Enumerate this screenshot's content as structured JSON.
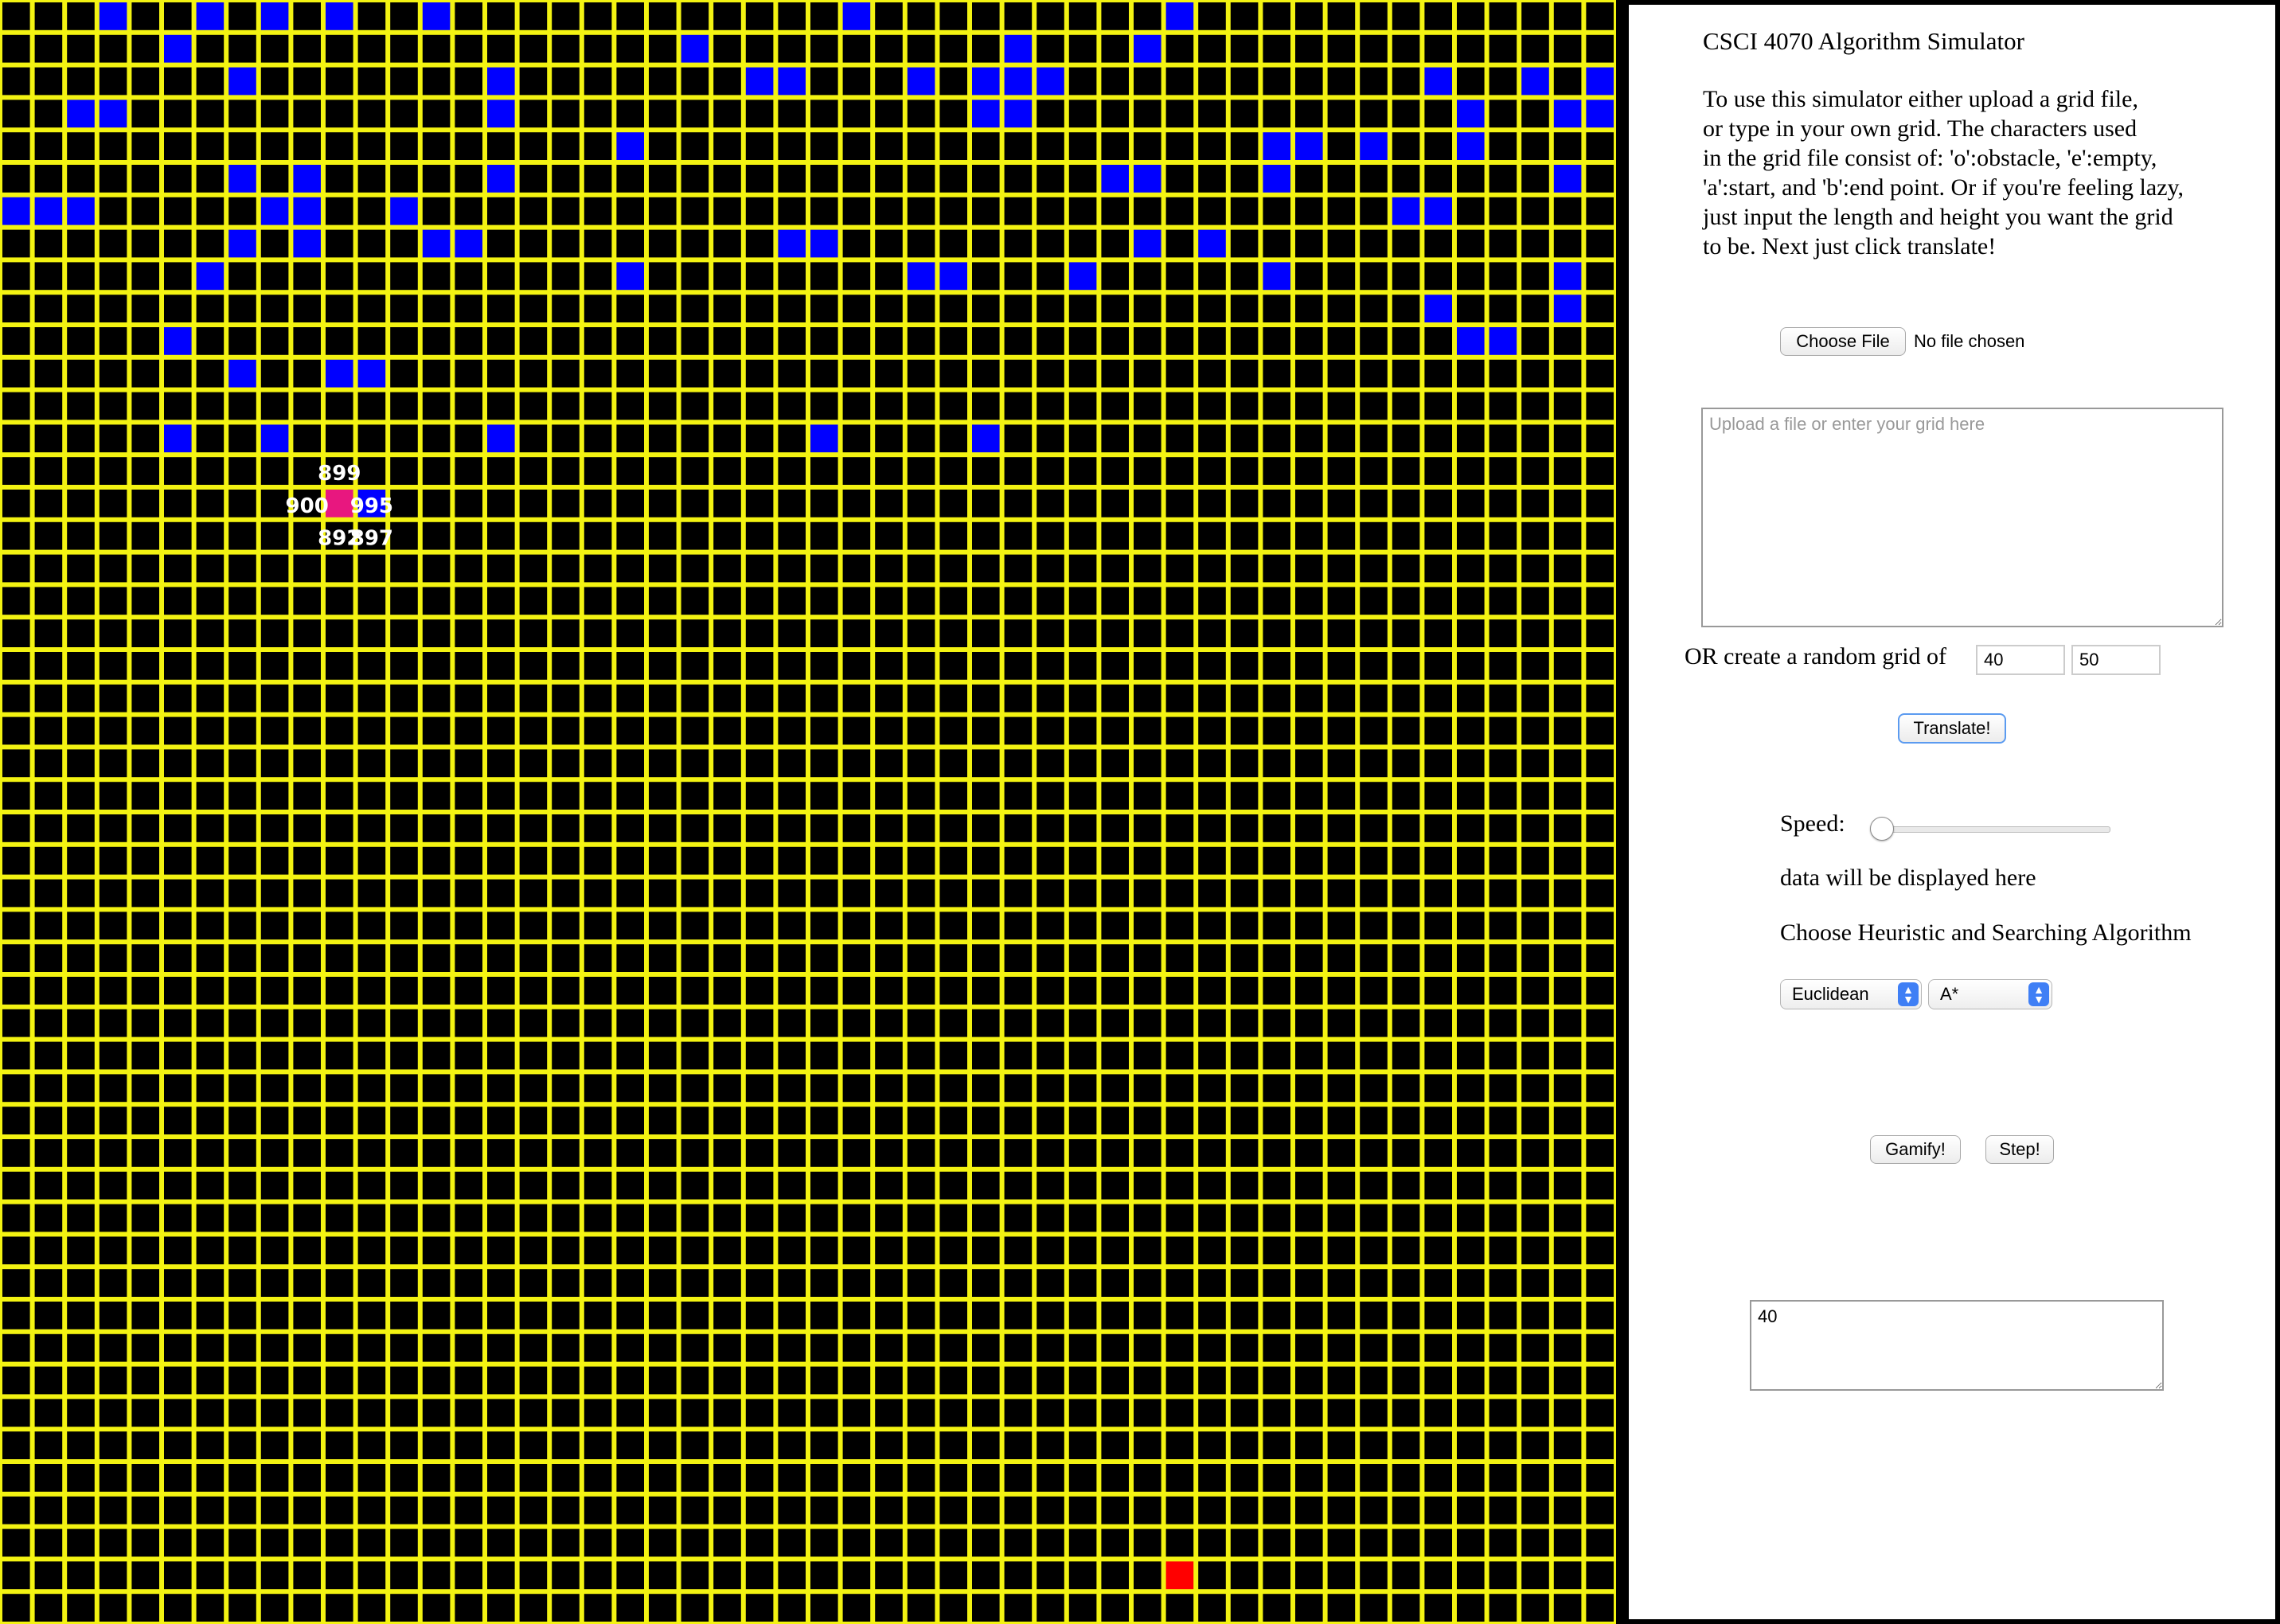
{
  "grid": {
    "rows": 50,
    "cols": 50,
    "colors": {
      "line": "#f3f312",
      "empty": "#000000",
      "obstacle": "#0000ff",
      "start": "#e8177f",
      "end": "#ff0000",
      "label": "#ffffff"
    },
    "cells": [
      "eeeoeeoeoeoeeoeeeeeeeeeeeeoeeeeeeeeeoeeeeeeeeeeeee",
      "eeeeeoeeeeeeeeeeeeeeeoeeeeeeeeeoeeeoeeeeeeeeeeeeee",
      "eeeeeeeoeeeeeeeoeeeeeeeooeeeoeoooeeeeeeeeeeeoeeoeo",
      "eeooeeeeeeeeeeeoeeeeeeeeeeeeeeooeeeeeeeeeeeeeoeeoo",
      "eeeeeeeeeeeeeeeeeeeoeeeeeeeeeeeeeeeeeeeooeoeeoeeee",
      "eeeeeeeoeoeeeeeoeeeeeeeeeeeeeeeeeeooeeeoeeeeeeeeoe",
      "oooeeeeeooeeoeeeeeeeeeeeeeeeeeeeeeeeeeeeeeeooeeeee",
      "eeeeeeeoeoeeeooeeeeeeeeeooeeeeeeeeeoeoeeeeeeeeeeee",
      "eeeeeeoeeeeeeeeeeeeoeeeeeeeeooeeeoeeeeeoeeeeeeeeoe",
      "eeeeeeeeeeeeeeeeeeeeeeeeeeeeeeeeeeeeeeeeeeeeoeeeoe",
      "eeeeeoeeeeeeeeeeeeeeeeeeeeeeeeeeeeeeeeeeeeeeeooeee",
      "eeeeeeeoeeooeeeeeeeeeeeeeeeeeeeeeeeeeeeeeeeeeeeeee",
      "eeeeeeeeeeeeeeeeeeeeeeeeeeeeeeeeeeeeeeeeeeeeeeeeee",
      "eeeeeoeeoeeeeeeoeeeeeeeeeoeeeeoeeeeeeeeeeeeeeeeeee",
      "eeeeeeeeeeeeeeeeeeeeeeeeeeeeeeeeeeeeeeeeeeeeeeeeee",
      "eeeeeeeeeeeoeeeeeeeeeeeeeeeeeeeeeeeeeeeeeeeeeeeeee",
      "eeeeeeeeeeeeeeeeeeeeeeeeeeeeeeeeeeeeeeeeeeeeeeeeee",
      "eeeeeeeeeeeeeeeeeeeeeeeeeeeeeeeeeeeeeeeeeeeeeeeeee",
      "eeeeeeeeeeeeeeeeeeeeeeeeeeeeeeeeeeeeeeeeeeeeeeeeee",
      "eeeeeeeeeeeeeeeeeeeeeeeeeeeeeeeeeeeeeeeeeeeeeeeeee",
      "eeeeeeeeeeeeeeeeeeeeeeeeeeeeeeeeeeeeeeeeeeeeeeeeee",
      "eeeeeeeeeeeeeeeeeeeeeeeeeeeeeeeeeeeeeeeeeeeeeeeeee",
      "eeeeeeeeeeeeeeeeeeeeeeeeeeeeeeeeeeeeeeeeeeeeeeeeee",
      "eeeeeeeeeeeeeeeeeeeeeeeeeeeeeeeeeeeeeeeeeeeeeeeeee",
      "eeeeeeeeeeeeeeeeeeeeeeeeeeeeeeeeeeeeeeeeeeeeeeeeee",
      "eeeeeeeeeeeeeeeeeeeeeeeeeeeeeeeeeeeeeeeeeeeeeeeeee",
      "eeeeeeeeeeeeeeeeeeeeeeeeeeeeeeeeeeeeeeeeeeeeeeeeee",
      "eeeeeeeeeeeeeeeeeeeeeeeeeeeeeeeeeeeeeeeeeeeeeeeeee",
      "eeeeeeeeeeeeeeeeeeeeeeeeeeeeeeeeeeeeeeeeeeeeeeeeee",
      "eeeeeeeeeeeeeeeeeeeeeeeeeeeeeeeeeeeeeeeeeeeeeeeeee",
      "eeeeeeeeeeeeeeeeeeeeeeeeeeeeeeeeeeeeeeeeeeeeeeeeee",
      "eeeeeeeeeeeeeeeeeeeeeeeeeeeeeeeeeeeeeeeeeeeeeeeeee",
      "eeeeeeeeeeeeeeeeeeeeeeeeeeeeeeeeeeeeeeeeeeeeeeeeee",
      "eeeeeeeeeeeeeeeeeeeeeeeeeeeeeeeeeeeeeeeeeeeeeeeeee",
      "eeeeeeeeeeeeeeeeeeeeeeeeeeeeeeeeeeeeeeeeeeeeeeeeee",
      "eeeeeeeeeeeeeeeeeeeeeeeeeeeeeeeeeeeeeeeeeeeeeeeeee",
      "eeeeeeeeeeeeeeeeeeeeeeeeeeeeeeeeeeeeeeeeeeeeeeeeee",
      "eeeeeeeeeeeeeeeeeeeeeeeeeeeeeeeeeeeeeeeeeeeeeeeeee",
      "eeeeeeeeeeeeeeeeeeeeeeeeeeeeeeeeeeeeeeeeeeeeeeeeee",
      "eeeeeeeeeeeeeeeeeeeeeeeeeeeeeeeeeeeeeeeeeeeeeeeeee",
      "eeeeeeeeeeeeeeeeeeeeeeeeeeeeeeeeeeeeeeeeeeeeeeeeee",
      "eeeeeeeeeeeeeeeeeeeeeeeeeeeeeeeeeeeeeeeeeeeeeeeeee",
      "eeeeeeeeeeeeeeeeeeeeeeeeeeeeeeeeeeeeeeeeeeeeeeeeee",
      "eeeeeeeeeeeeeeeeeeeeeeeeeeeeeeeeeeeeeeeeeeeeeeeeee",
      "eeeeeeeeeeeeeeeeeeeeeeeeeeeeeeeeeeeeeeeeeeeeeeeeee",
      "eeeeeeeeeeeeeeeeeeeeeeeeeeeeeeeeeeeeeeeeeeeeeeeeee",
      "eeeeeeeeeeeeeeeeeeeeeeeeeeeeeeeeeeeeeeeeeeeeeeeeee",
      "eeeeeeeeeeeeeeeeeeeeeeeeeeeeeeeeeeeeeeeeeeeeeeeeee",
      "eeeeeeeeeeeeeeeeeeeeeeeeeeeeeeeeeeeeeeeeeeeeeeeeee",
      "eeeeeeeeeeeeeeeeeeeeeeeeeeeeeeeeeeeeeeeeeeeeeeeeee"
    ],
    "start": {
      "row": 15,
      "col": 10
    },
    "end": {
      "row": 48,
      "col": 36
    },
    "cost_labels": [
      {
        "row": 14,
        "col": 10,
        "text": "899"
      },
      {
        "row": 15,
        "col": 9,
        "text": "900"
      },
      {
        "row": 15,
        "col": 11,
        "text": "995"
      },
      {
        "row": 16,
        "col": 10,
        "text": "892"
      },
      {
        "row": 16,
        "col": 11,
        "text": "897"
      }
    ]
  },
  "panel": {
    "title": "CSCI 4070 Algorithm Simulator",
    "description_lines": [
      "To use this simulator either upload a grid file,",
      "or type in your own grid. The characters used",
      "in the grid file consist of: 'o':obstacle, 'e':empty,",
      "'a':start, and 'b':end point. Or if you're feeling lazy,",
      "just input the length and height you want the grid",
      "to be. Next just click translate!"
    ],
    "file": {
      "button_label": "Choose File",
      "status": "No file chosen"
    },
    "grid_textarea": {
      "placeholder": "Upload a file or enter your grid here",
      "value": ""
    },
    "random": {
      "label": "OR create a random grid of",
      "length": "40",
      "height": "50"
    },
    "translate_label": "Translate!",
    "speed_label": "Speed:",
    "speed_value": 0,
    "data_text": "data will be displayed here",
    "choose_label": "Choose Heuristic and Searching Algorithm",
    "heuristic": "Euclidean",
    "algorithm": "A*",
    "gamify_label": "Gamify!",
    "step_label": "Step!",
    "output_value": "40"
  }
}
